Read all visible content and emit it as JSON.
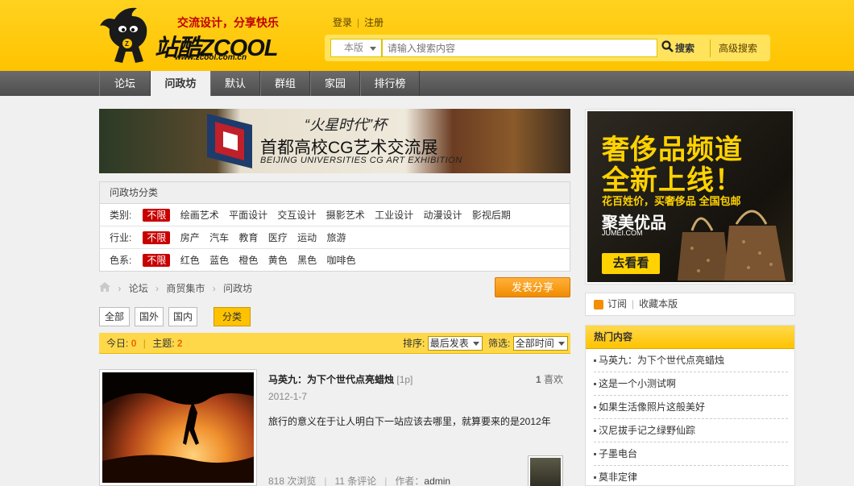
{
  "header": {
    "slogan": "交流设计，分享快乐",
    "brand_text": "站酷ZCOOL",
    "brand_url": "www.zcool.com.cn",
    "login": "登录",
    "register": "注册",
    "search_scope": "本版",
    "search_placeholder": "请输入搜索内容",
    "search_button": "搜索",
    "advanced_search": "高级搜索"
  },
  "nav": {
    "items": [
      {
        "label": "论坛"
      },
      {
        "label": "问政坊"
      },
      {
        "label": "默认"
      },
      {
        "label": "群组"
      },
      {
        "label": "家园"
      },
      {
        "label": "排行榜"
      }
    ]
  },
  "banner": {
    "title1": "“火星时代”杯",
    "title2": "首都高校CG艺术交流展",
    "title3": "BEIJING UNIVERSITIES CG ART EXHIBITION"
  },
  "filter": {
    "header": "问政坊分类",
    "rows": [
      {
        "label": "类别:",
        "active": "不限",
        "options": [
          "绘画艺术",
          "平面设计",
          "交互设计",
          "摄影艺术",
          "工业设计",
          "动漫设计",
          "影视后期"
        ]
      },
      {
        "label": "行业:",
        "active": "不限",
        "options": [
          "房产",
          "汽车",
          "教育",
          "医疗",
          "运动",
          "旅游"
        ]
      },
      {
        "label": "色系:",
        "active": "不限",
        "options": [
          "红色",
          "蓝色",
          "橙色",
          "黄色",
          "黑色",
          "咖啡色"
        ]
      }
    ]
  },
  "breadcrumb": [
    "论坛",
    "商贸集市",
    "问政坊"
  ],
  "post_button": "发表分享",
  "tabs": [
    "全部",
    "国外",
    "国内",
    "分类"
  ],
  "sortbar": {
    "today_label": "今日:",
    "today_value": "0",
    "topics_label": "主题:",
    "topics_value": "2",
    "sort_label": "排序:",
    "sort_value": "最后发表",
    "filter_label": "筛选:",
    "filter_value": "全部时间"
  },
  "post": {
    "title": "马英九：为下个世代点亮蜡烛",
    "image_count": "[1p]",
    "likes_num": "1",
    "likes_label": "喜欢",
    "date": "2012-1-7",
    "description": "旅行的意义在于让人明白下一站应该去哪里，就算要来的是2012年",
    "views": "818 次浏览",
    "comments": "11 条评论",
    "author_label": "作者：",
    "author": "admin"
  },
  "ad": {
    "line1": "奢侈品频道",
    "line2": "全新上线！",
    "line3": "花百姓价，买奢侈品 全国包邮",
    "brand": "聚美优品",
    "brand_url": "JUMEI.COM",
    "button": "去看看"
  },
  "subscribe": {
    "subscribe": "订阅",
    "favorite": "收藏本版"
  },
  "hot": {
    "title": "热门内容",
    "items": [
      "马英九：为下个世代点亮蜡烛",
      "这是一个小测试啊",
      "如果生活像照片这般美好",
      "汉尼拔手记之绿野仙踪",
      "子墨电台",
      "莫非定律"
    ]
  }
}
